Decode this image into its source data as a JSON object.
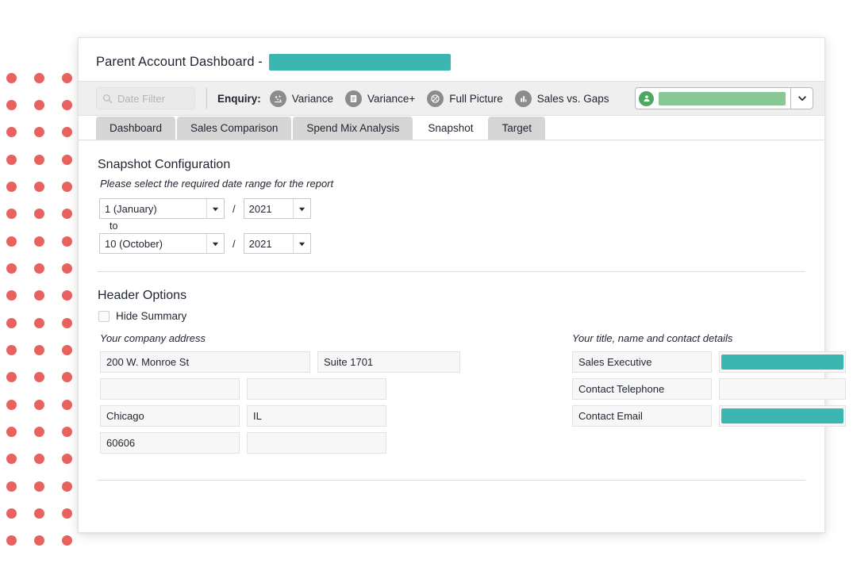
{
  "header": {
    "title": "Parent Account Dashboard -",
    "title_redacted_value": "",
    "accent_teal": "#3cb6b1",
    "accent_green": "#89c894",
    "dot_color": "#e8635f"
  },
  "toolbar": {
    "date_filter_placeholder": "Date Filter",
    "date_filter_value": "",
    "enquiry_label": "Enquiry:",
    "enquiry_items": [
      {
        "label": "Variance",
        "icon": "scatter-icon"
      },
      {
        "label": "Variance+",
        "icon": "report-icon"
      },
      {
        "label": "Full Picture",
        "icon": "pie-icon"
      },
      {
        "label": "Sales vs. Gaps",
        "icon": "bar-chart-icon"
      }
    ],
    "account_select": {
      "icon": "user-icon",
      "value_redacted": "",
      "caret": "chevron-down-icon"
    }
  },
  "tabs": [
    {
      "label": "Dashboard",
      "active": false
    },
    {
      "label": "Sales Comparison",
      "active": false
    },
    {
      "label": "Spend Mix Analysis",
      "active": false
    },
    {
      "label": "Snapshot",
      "active": true
    },
    {
      "label": "Target",
      "active": false
    }
  ],
  "snapshot_configuration": {
    "section_title": "Snapshot Configuration",
    "hint": "Please select the required date range for the report",
    "separator": "/",
    "to_label": "to",
    "from": {
      "month": "1 (January)",
      "year": "2021"
    },
    "to": {
      "month": "10 (October)",
      "year": "2021"
    }
  },
  "header_options": {
    "section_title": "Header Options",
    "hide_summary": {
      "label": "Hide Summary",
      "checked": false
    },
    "company_address": {
      "hint": "Your company address",
      "rows": [
        {
          "line1": "200 W. Monroe St",
          "line2": "Suite 1701"
        },
        {
          "line1": "",
          "line2": ""
        },
        {
          "line1": "Chicago",
          "line2": "IL"
        },
        {
          "line1": "60606",
          "line2": ""
        }
      ]
    },
    "contact_details": {
      "hint": "Your title, name and contact details",
      "rows": [
        {
          "label": "Sales Executive",
          "value": "",
          "redacted": true
        },
        {
          "label": "Contact Telephone",
          "value": "",
          "redacted": false
        },
        {
          "label": "Contact Email",
          "value": "",
          "redacted": true
        }
      ]
    }
  }
}
